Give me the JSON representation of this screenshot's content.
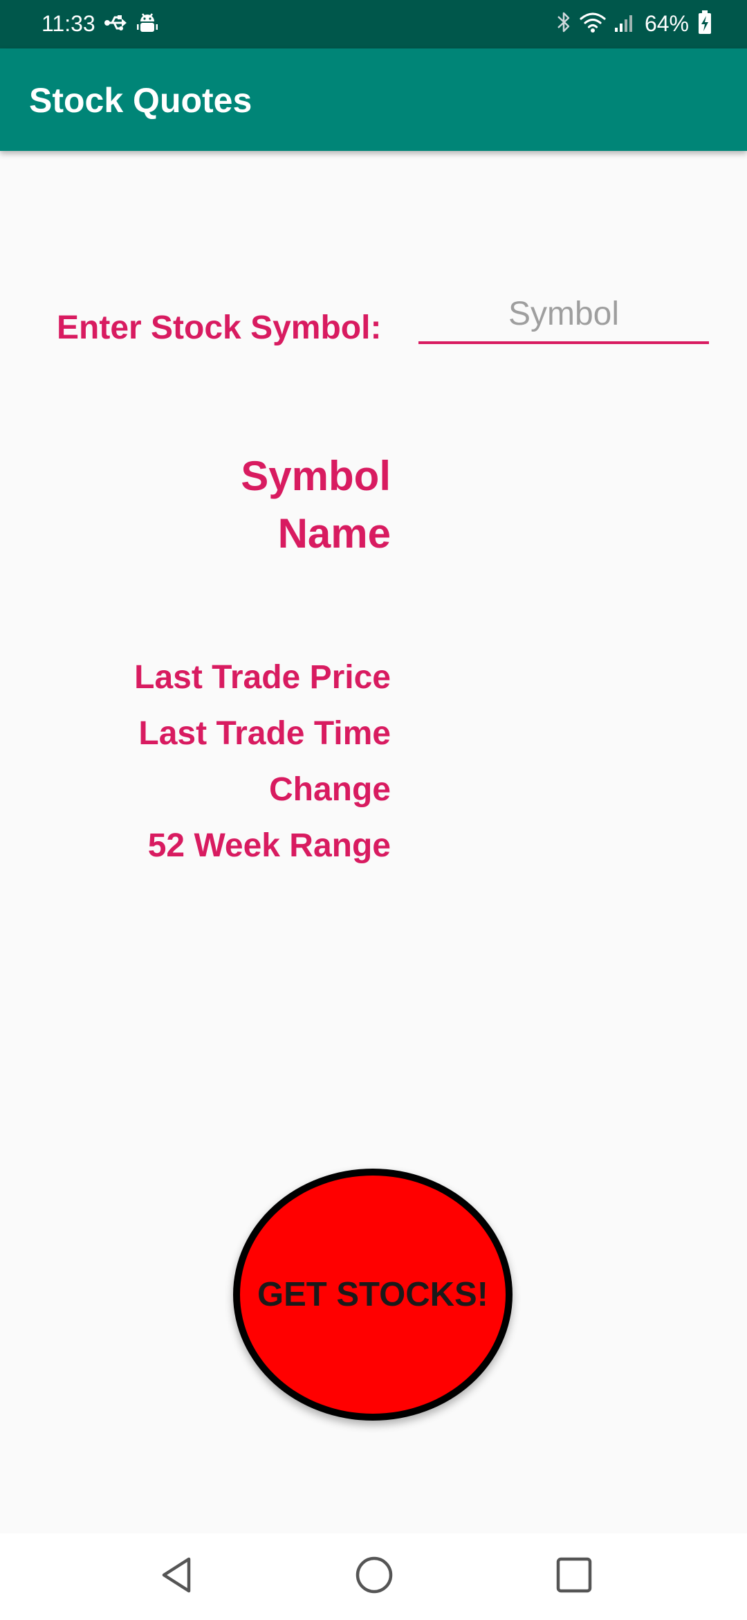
{
  "status_bar": {
    "time": "11:33",
    "battery": "64%",
    "bg_color": "#00574b",
    "left_icons": [
      "usb-icon",
      "android-debug-icon"
    ],
    "right_icons": [
      "bluetooth-icon",
      "wifi-icon",
      "cell-signal-icon",
      "battery-charging-icon"
    ]
  },
  "app_bar": {
    "title": "Stock Quotes",
    "color": "#008577"
  },
  "form": {
    "enter_label": "Enter Stock Symbol:",
    "symbol_value": "",
    "symbol_placeholder": "Symbol"
  },
  "heading": {
    "line1": "Symbol",
    "line2": "Name"
  },
  "details": [
    "Last Trade Price",
    "Last Trade Time",
    "Change",
    "52 Week Range"
  ],
  "accent_color": "#d81b60",
  "button": {
    "label": "GET STOCKS!",
    "fill_color": "#ff0000",
    "border_color": "#000000"
  },
  "nav": {
    "buttons": [
      "back-icon",
      "home-icon",
      "recents-icon"
    ]
  }
}
